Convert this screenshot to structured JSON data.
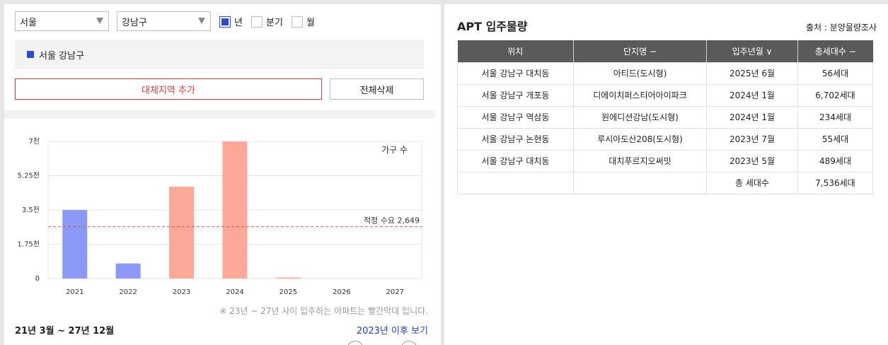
{
  "filters": {
    "city": "서울",
    "district": "강남구",
    "options": [
      {
        "label": "년",
        "checked": true
      },
      {
        "label": "분기",
        "checked": false
      },
      {
        "label": "월",
        "checked": false
      }
    ]
  },
  "region_tag": "서울 강남구",
  "buttons": {
    "alt_region": "대체지역 추가",
    "delete_all": "전체삭제"
  },
  "chart_data": {
    "type": "bar",
    "categories": [
      "2021",
      "2022",
      "2023",
      "2024",
      "2025",
      "2026",
      "2027"
    ],
    "values": [
      3500,
      770,
      4690,
      7000,
      56,
      0,
      0
    ],
    "bar_colors": [
      "#8c9af7",
      "#8c9af7",
      "#fba899",
      "#fba899",
      "#fba899",
      "#fba899",
      "#fba899"
    ],
    "ytick_labels": [
      "0",
      "1.75천",
      "3.5천",
      "5.25천",
      "7천"
    ],
    "yticks": [
      0,
      1750,
      3500,
      5250,
      7000
    ],
    "ylim": [
      0,
      7000
    ],
    "series_label": "가구 수",
    "reference_line": {
      "value": 2649,
      "label": "적정 수요 2,649",
      "color": "#e05050"
    }
  },
  "note": "※ 23년 ~ 27년 사이 입주하는 아파트는 빨간막대 입니다.",
  "period": "21년 3월 ~ 27년 12월",
  "more_link": "2023년 이후 보기",
  "right": {
    "title": "APT 입주물량",
    "source": "출처 : 분양물량조사",
    "headers": [
      "위치",
      "단지명 −",
      "입주년월 ∨",
      "총세대수 −"
    ],
    "rows": [
      [
        "서울 강남구 대치동",
        "아티드(도시형)",
        "2025년 6월",
        "56세대"
      ],
      [
        "서울 강남구 개포동",
        "디에이치퍼스티어아이파크",
        "2024년 1월",
        "6,702세대"
      ],
      [
        "서울 강남구 역삼동",
        "원에디션강남(도시형)",
        "2024년 1월",
        "234세대"
      ],
      [
        "서울 강남구 논현동",
        "루시아도산208(도시형)",
        "2023년 7월",
        "55세대"
      ],
      [
        "서울 강남구 대치동",
        "대치푸르지오써밋",
        "2023년 5월",
        "489세대"
      ]
    ],
    "total_label": "총 세대수",
    "total_value": "7,536세대"
  }
}
